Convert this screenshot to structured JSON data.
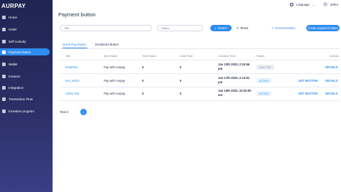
{
  "app": {
    "logo": "AURPAY"
  },
  "sidebar": {
    "items": [
      {
        "label": "Home",
        "icon": "home-icon"
      },
      {
        "label": "Order",
        "icon": "order-icon"
      },
      {
        "label": "Self custody",
        "icon": "wallet-icon"
      },
      {
        "label": "Payment button",
        "icon": "button-icon",
        "active": true
      },
      {
        "label": "Wallet",
        "icon": "wallet-icon"
      },
      {
        "label": "Invoices",
        "icon": "invoice-icon"
      },
      {
        "label": "Integration",
        "icon": "integration-icon"
      },
      {
        "label": "Transaction Flow",
        "icon": "flow-icon"
      },
      {
        "label": "Incentive program",
        "icon": "gift-icon"
      }
    ]
  },
  "header": {
    "title": "Payment button",
    "language": "Language",
    "user": "arthur"
  },
  "filters": {
    "title_placeholder": "Title",
    "status_placeholder": "Status",
    "search_label": "Search",
    "reset_label": "Reset",
    "documentation_label": "Documentation",
    "create_label": "Create payment button"
  },
  "tabs": [
    {
      "label": "Quick-Pay Button",
      "active": true
    },
    {
      "label": "Donations Button",
      "active": false
    }
  ],
  "table": {
    "columns": [
      "Title",
      "Item Name",
      "Total Sales",
      "Units Sold",
      "Creation Time",
      "Status",
      "Actions"
    ],
    "rows": [
      {
        "title": "testarthur",
        "item": "Pay with Aurpay",
        "sales": "0",
        "units": "0",
        "time1": "Jan 13th 2023, 2:24:56",
        "time2": "pm",
        "status": "INACTIVE",
        "get": "",
        "details": "DETAILS"
      },
      {
        "title": "test_arthur",
        "item": "Pay with Aurpay",
        "sales": "0",
        "units": "0",
        "time1": "Jan 17th 2023, 2:14:51",
        "time2": "pm",
        "status": "ACTIVE",
        "get": "GET BUTTON",
        "details": "DETAILS"
      },
      {
        "title": "Arthur test",
        "item": "Pay with Aurpay",
        "sales": "0",
        "units": "0",
        "time1": "Jan 10th 2023, 10:20:00",
        "time2": "am",
        "status": "ACTIVE",
        "get": "GET BUTTON",
        "details": "DETAILS"
      }
    ]
  },
  "pagination": {
    "total": "Total 3",
    "current": "1"
  },
  "colors": {
    "accent": "#2f8cf0",
    "sidebar": "#23285a"
  }
}
